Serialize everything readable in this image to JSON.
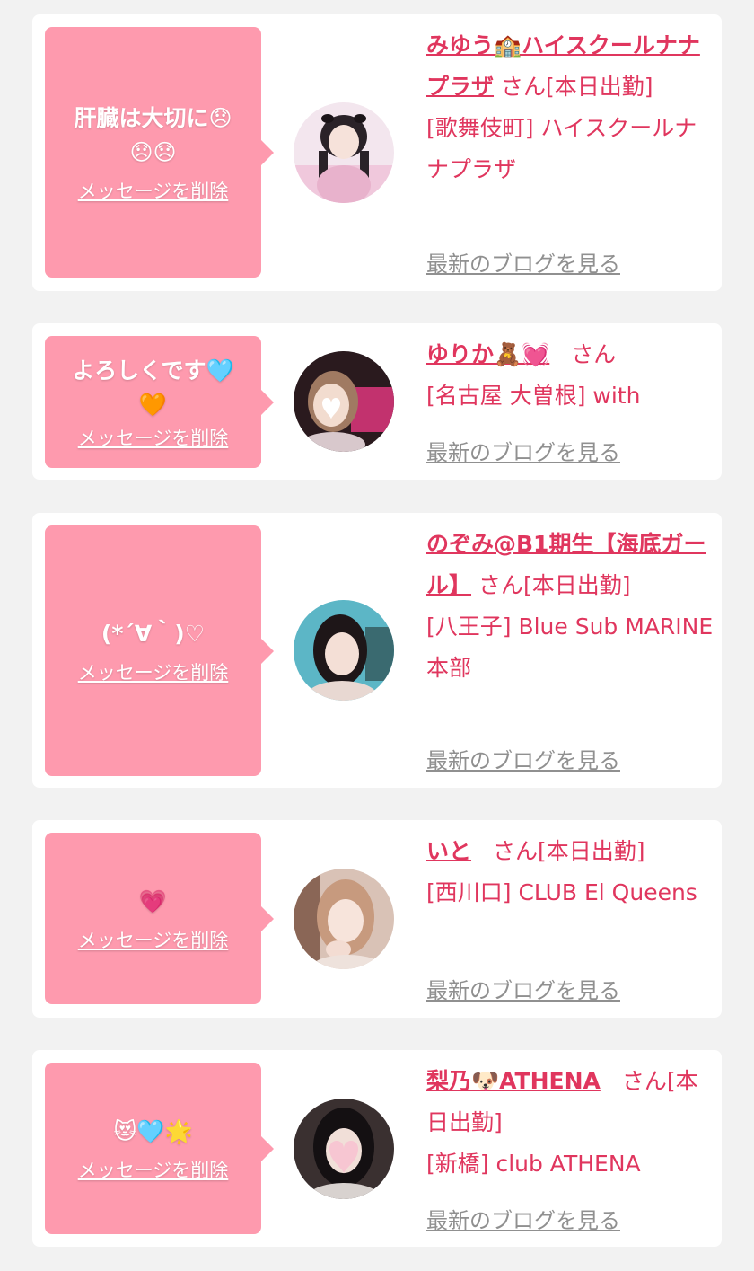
{
  "cards": [
    {
      "message": "肝臓は大切に😞😞😞",
      "delete_label": "メッセージを削除",
      "name": "みゆう🏫ハイスクールナナプラザ",
      "suffix": "さん[本日出勤]",
      "shop": "[歌舞伎町] ハイスクールナナプラザ",
      "blog_label": "最新のブログを見る",
      "avatar": "avatar-photo-1"
    },
    {
      "message": "よろしくです🩵🧡",
      "delete_label": "メッセージを削除",
      "name": "ゆりか🧸💓",
      "suffix": "さん",
      "shop": "[名古屋 大曽根] with",
      "blog_label": "最新のブログを見る",
      "avatar": "avatar-photo-2"
    },
    {
      "message": "(*´∀｀)♡",
      "delete_label": "メッセージを削除",
      "name": "のぞみ@B1期生【海底ガール】",
      "suffix": "さん[本日出勤]",
      "shop": "[八王子] Blue Sub MARINE 本部",
      "blog_label": "最新のブログを見る",
      "avatar": "avatar-photo-3"
    },
    {
      "message": "💗",
      "delete_label": "メッセージを削除",
      "name": "いと",
      "suffix": "さん[本日出勤]",
      "shop": "[西川口] CLUB El Queens",
      "blog_label": "最新のブログを見る",
      "avatar": "avatar-photo-4"
    },
    {
      "message": "😻🩵🌟",
      "delete_label": "メッセージを削除",
      "name": "梨乃🐶ATHENA",
      "suffix": "さん[本日出勤]",
      "shop": "[新橋] club ATHENA",
      "blog_label": "最新のブログを見る",
      "avatar": "avatar-photo-5"
    }
  ],
  "colors": {
    "bubble": "#fe9aae",
    "accent": "#e0365e",
    "link_gray": "#909090",
    "card_bg": "#ffffff",
    "page_bg": "#f2f2f2"
  }
}
